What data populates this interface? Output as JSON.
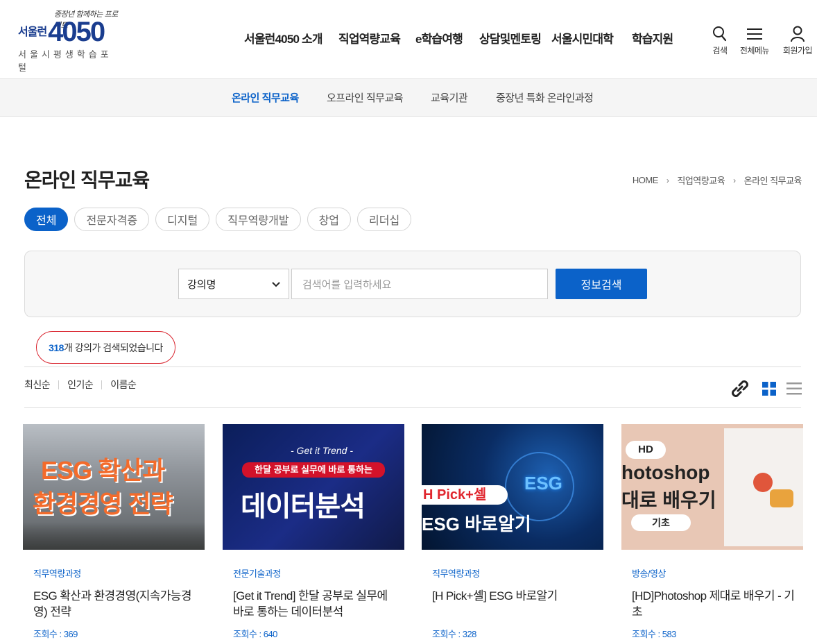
{
  "header": {
    "logo_tagline": "중장년 함께하는 프로젝트",
    "logo_seoul": "서울런",
    "logo_number": "4050",
    "logo_sub": "서울시평생학습포털",
    "nav": [
      "서울런4050 소개",
      "직업역량교육",
      "e학습여행",
      "상담및멘토링",
      "서울시민대학",
      "학습지원"
    ],
    "util": {
      "search": "검색",
      "menu": "전체메뉴",
      "join": "회원가입"
    }
  },
  "subnav": [
    "온라인 직무교육",
    "오프라인 직무교육",
    "교육기관",
    "중장년 특화 온라인과정"
  ],
  "page": {
    "title": "온라인 직무교육",
    "breadcrumb": [
      "HOME",
      "직업역량교육",
      "온라인 직무교육"
    ]
  },
  "chips": [
    "전체",
    "전문자격증",
    "디지털",
    "직무역량개발",
    "창업",
    "리더십"
  ],
  "search": {
    "select_value": "강의명",
    "placeholder": "검색어를 입력하세요",
    "button": "정보검색"
  },
  "result": {
    "count": "318",
    "suffix": "개 강의가 검색되었습니다"
  },
  "sort": [
    "최신순",
    "인기순",
    "이름순"
  ],
  "cards": [
    {
      "category": "직무역량과정",
      "title": "ESG 확산과 환경경영(지속가능경영) 전략",
      "views": "조회수 : 369",
      "thumb_text": [
        "ESG 확산과",
        "환경경영 전략"
      ]
    },
    {
      "category": "전문기술과정",
      "title": "[Get it Trend] 한달 공부로 실무에 바로 통하는 데이터분석",
      "views": "조회수 : 640",
      "thumb_text": [
        "- Get it Trend -",
        "한달 공부로 실무에 바로 통하는",
        "데이터분석"
      ]
    },
    {
      "category": "직무역량과정",
      "title": "[H Pick+셀] ESG 바로알기",
      "views": "조회수 : 328",
      "thumb_text": [
        "ESG",
        "H Pick+셀",
        "ESG 바로알기"
      ]
    },
    {
      "category": "방송/영상",
      "title": "[HD]Photoshop 제대로 배우기 - 기초",
      "views": "조회수 : 583",
      "thumb_text": [
        "HD",
        "hotoshop",
        "대로 배우기",
        "기초"
      ]
    }
  ],
  "colors": {
    "accent": "#0b62c9",
    "result_border": "#d9232d",
    "logo": "#1a3d8f"
  }
}
